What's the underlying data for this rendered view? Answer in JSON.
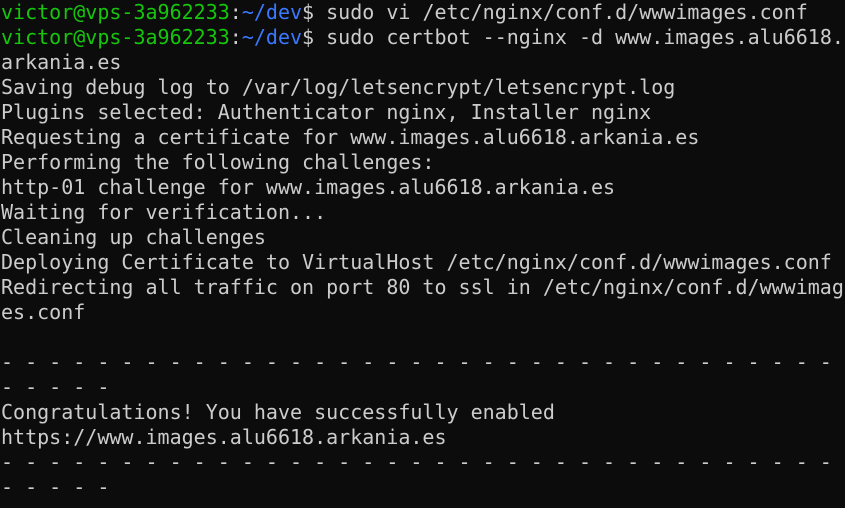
{
  "terminal": {
    "prompt": {
      "user_host": "victor@vps-3a962233",
      "separator": ":",
      "path": "~/dev",
      "symbol": "$ "
    },
    "commands": [
      "sudo vi /etc/nginx/conf.d/wwwimages.conf",
      "sudo certbot --nginx -d www.images.alu6618."
    ],
    "output": [
      "arkania.es",
      "Saving debug log to /var/log/letsencrypt/letsencrypt.log",
      "Plugins selected: Authenticator nginx, Installer nginx",
      "Requesting a certificate for www.images.alu6618.arkania.es",
      "Performing the following challenges:",
      "http-01 challenge for www.images.alu6618.arkania.es",
      "Waiting for verification...",
      "Cleaning up challenges",
      "Deploying Certificate to VirtualHost /etc/nginx/conf.d/wwwimages.conf",
      "Redirecting all traffic on port 80 to ssl in /etc/nginx/conf.d/wwwimag",
      "es.conf",
      "",
      "- - - - - - - - - - - - - - - - - - - - - - - - - - - - - - - - - - - -",
      "- - - - -",
      "Congratulations! You have successfully enabled",
      "https://www.images.alu6618.arkania.es",
      "- - - - - - - - - - - - - - - - - - - - - - - - - - - - - - - - - - - -",
      "- - - - -"
    ],
    "colors": {
      "background": "#0c0c0c",
      "text": "#cccccc",
      "prompt_user": "#16c60c",
      "prompt_path": "#3b78ff"
    }
  }
}
